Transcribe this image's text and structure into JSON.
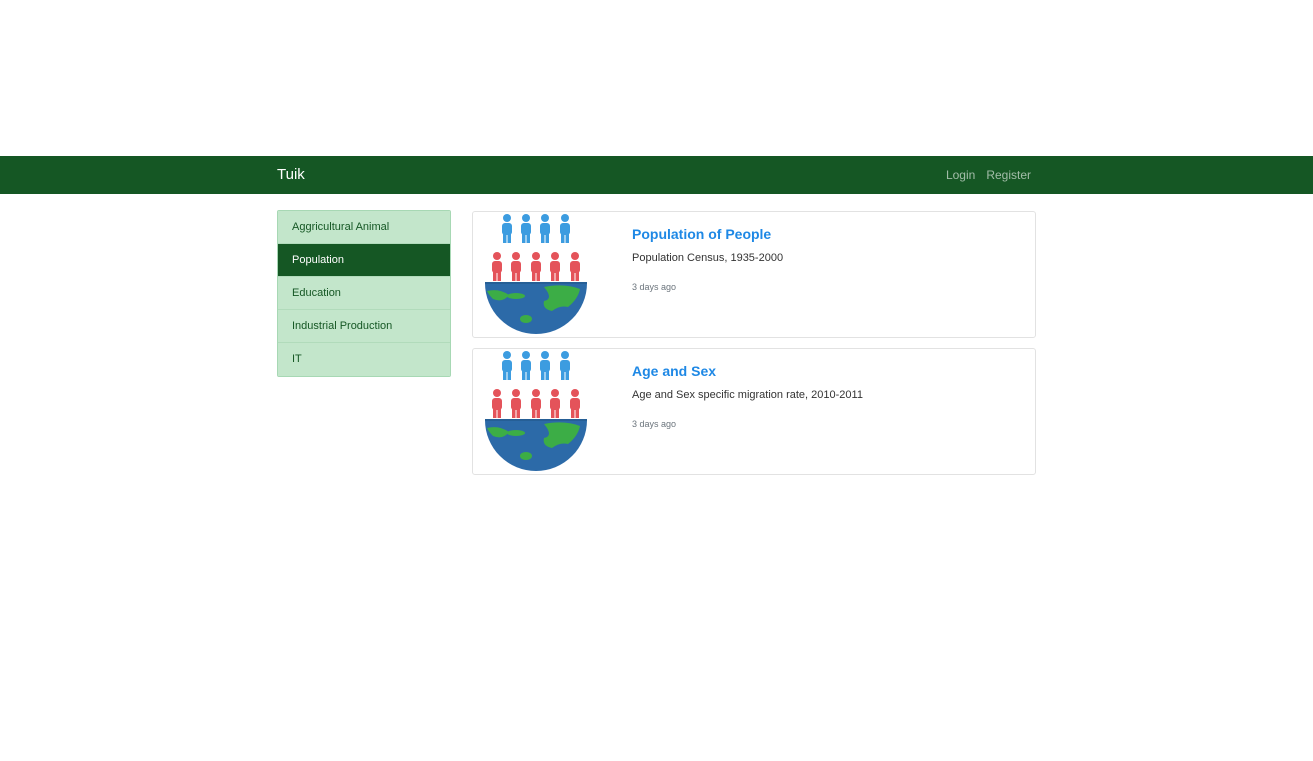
{
  "navbar": {
    "brand": "Tuik",
    "links": [
      {
        "label": "Login"
      },
      {
        "label": "Register"
      }
    ],
    "color": "#155724"
  },
  "sidebar": {
    "items": [
      {
        "label": "Aggricultural Animal",
        "active": false
      },
      {
        "label": "Population",
        "active": true
      },
      {
        "label": "Education",
        "active": false
      },
      {
        "label": "Industrial Production",
        "active": false
      },
      {
        "label": "IT",
        "active": false
      }
    ]
  },
  "cards": [
    {
      "title": "Population of People",
      "description": "Population Census, 1935-2000",
      "time": "3 days ago",
      "icon": "population-globe-icon"
    },
    {
      "title": "Age and Sex",
      "description": "Age and Sex specific migration rate, 2010-2011",
      "time": "3 days ago",
      "icon": "population-globe-icon"
    }
  ],
  "colors": {
    "accent": "#155724",
    "sidebar_bg": "#c3e6cb",
    "title_link": "#1e88e5",
    "people_top": "#3c9ce0",
    "people_bottom": "#e4535a",
    "globe_water": "#2c6aa8",
    "globe_land": "#3cad46"
  }
}
